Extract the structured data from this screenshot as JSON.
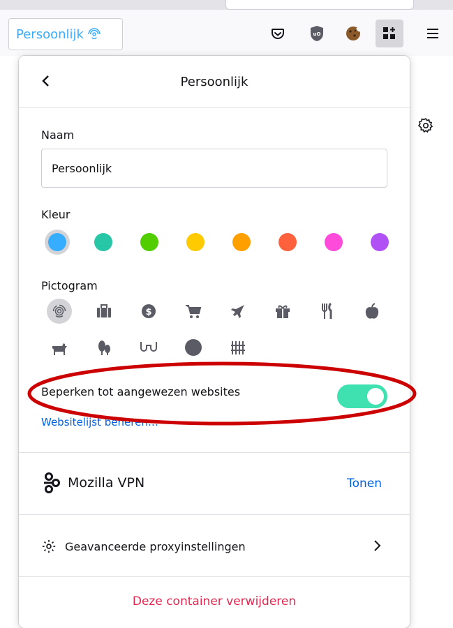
{
  "toolbar": {
    "container_tab_label": "Persoonlijk",
    "icons": [
      "fingerprint-icon",
      "pocket-icon",
      "ublock-icon",
      "cookie-icon",
      "containers-icon",
      "hamburger-menu-icon"
    ]
  },
  "panel": {
    "title": "Persoonlijk",
    "name": {
      "label": "Naam",
      "value": "Persoonlijk"
    },
    "color": {
      "label": "Kleur",
      "options": [
        "#37adff",
        "#26c6a6",
        "#51cd00",
        "#ffcb00",
        "#ff9f00",
        "#ff613d",
        "#ff4bda",
        "#af51f5"
      ],
      "selected_index": 0
    },
    "icon": {
      "label": "Pictogram",
      "options": [
        "fingerprint",
        "briefcase",
        "dollar",
        "cart",
        "vacation",
        "gift",
        "food",
        "fruit",
        "pet",
        "tree",
        "chill",
        "circle",
        "fence"
      ],
      "selected_index": 0
    },
    "restrict": {
      "label": "Beperken tot aangewezen websites",
      "enabled": true
    },
    "manage_sites_label": "Websitelijst beheren…",
    "vpn": {
      "label": "Mozilla VPN",
      "action_label": "Tonen"
    },
    "proxy": {
      "label": "Geavanceerde proxyinstellingen"
    },
    "delete_label": "Deze container verwijderen"
  },
  "annotation": {
    "color": "#cc0000"
  }
}
